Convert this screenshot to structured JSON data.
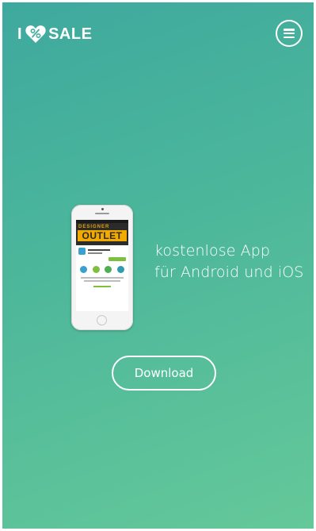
{
  "header": {
    "logo_prefix": "I",
    "logo_icon": "heart-percent-icon",
    "logo_suffix": "SALE",
    "menu_icon": "hamburger-menu-icon"
  },
  "phone_mockup": {
    "banner_top": "DESIGNER",
    "banner_main": "OUTLET"
  },
  "hero": {
    "line1": "kostenlose  App",
    "line2": "für Android und iOS"
  },
  "cta": {
    "download_label": "Download"
  },
  "colors": {
    "gradient_start": "#3ea99e",
    "gradient_end": "#64c899",
    "foreground": "#ffffff"
  }
}
